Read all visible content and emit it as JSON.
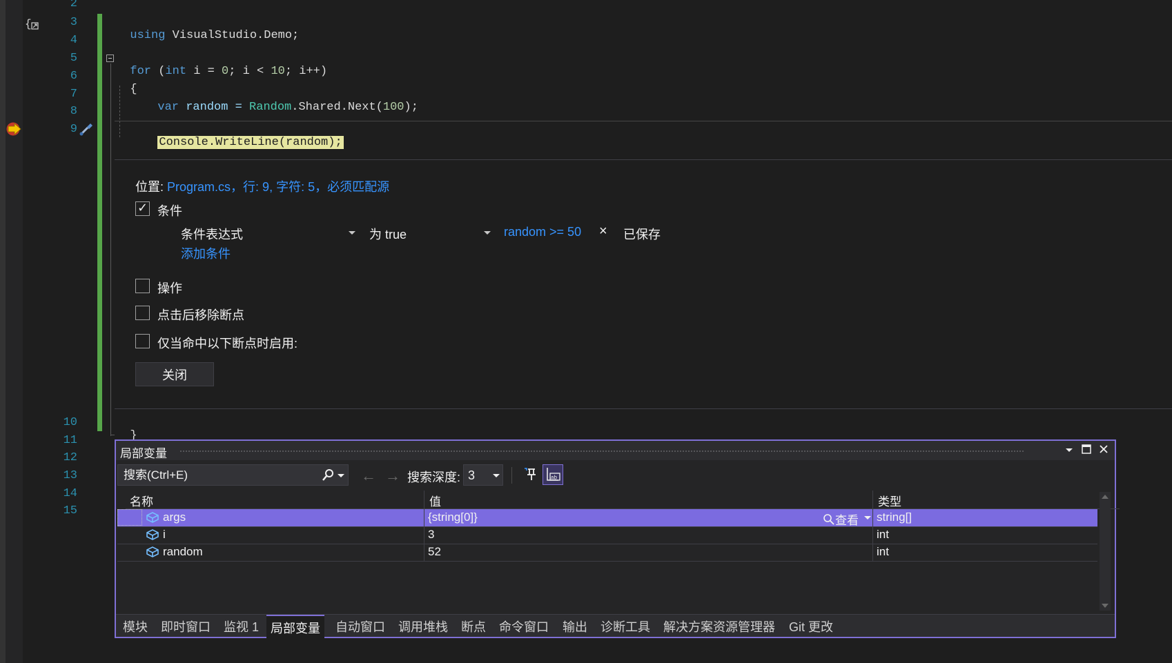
{
  "editor": {
    "line_numbers": [
      "2",
      "3",
      "4",
      "5",
      "6",
      "7",
      "8",
      "9",
      "10",
      "11",
      "12",
      "13",
      "14",
      "15"
    ],
    "code": {
      "l3_kw": "using",
      "l3_rest": " VisualStudio.Demo;",
      "l5_for": "for",
      "l5_open": " (",
      "l5_int": "int",
      "l5_i": " i = ",
      "l5_zero": "0",
      "l5_mid": "; i < ",
      "l5_ten": "10",
      "l5_end": "; i++)",
      "l6": "{",
      "l7_var": "var",
      "l7_random": " random = ",
      "l7_type": "Random",
      "l7_rest": ".Shared.Next(",
      "l7_num": "100",
      "l7_end": ");",
      "l9": "Console.WriteLine(random);",
      "l10": "}"
    }
  },
  "breakpoint_settings": {
    "location_label": "位置:",
    "location_value": "Program.cs，行: 9, 字符: 5，必须匹配源",
    "conditions_label": "条件",
    "conditions_checked": true,
    "condition_kind": "条件表达式",
    "condition_mode": "为 true",
    "condition_expr": "random >= 50",
    "saved_label": "已保存",
    "add_condition": "添加条件",
    "actions_label": "操作",
    "remove_after_hit_label": "点击后移除断点",
    "only_enable_label": "仅当命中以下断点时启用:",
    "close_button": "关闭"
  },
  "locals_window": {
    "title": "局部变量",
    "search_placeholder": "搜索(Ctrl+E)",
    "search_depth_label": "搜索深度:",
    "search_depth_value": "3",
    "columns": {
      "name": "名称",
      "value": "值",
      "type": "类型"
    },
    "rows": [
      {
        "name": "args",
        "value": "{string[0]}",
        "type": "string[]",
        "selected": true
      },
      {
        "name": "i",
        "value": "3",
        "type": "int",
        "selected": false
      },
      {
        "name": "random",
        "value": "52",
        "type": "int",
        "selected": false
      }
    ],
    "view_label": "查看",
    "tabs": [
      "模块",
      "即时窗口",
      "监视 1",
      "局部变量",
      "自动窗口",
      "调用堆栈",
      "断点",
      "命令窗口",
      "输出",
      "诊断工具",
      "解决方案资源管理器",
      "Git 更改"
    ],
    "active_tab": "局部变量"
  },
  "colors": {
    "accent": "#7f70d6",
    "selected_row": "#7b6be0",
    "change_bar": "#57a64a",
    "breakpoint_arrow": "#e8a500"
  }
}
